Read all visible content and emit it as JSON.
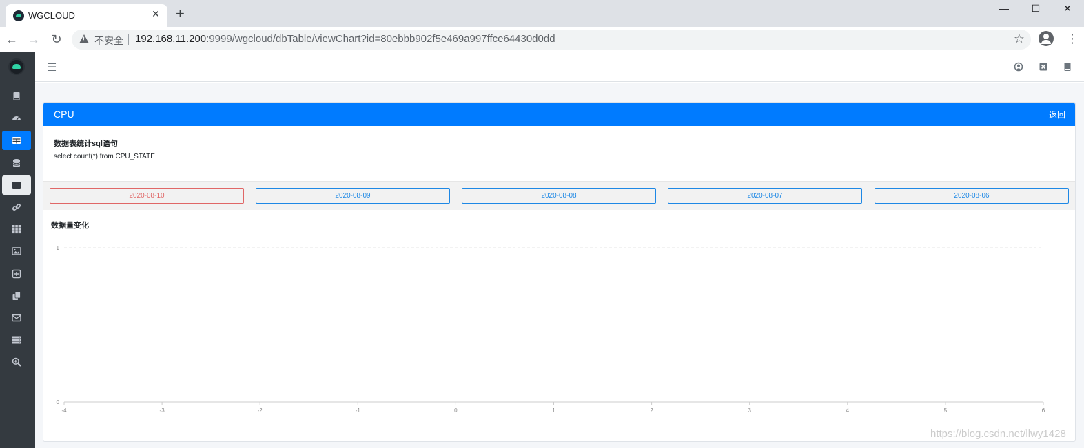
{
  "browser": {
    "tab_title": "WGCLOUD",
    "insecure_label": "不安全",
    "url_host": "192.168.11.200",
    "url_rest": ":9999/wgcloud/dbTable/viewChart?id=80ebbb902f5e469a997ffce64430d0dd"
  },
  "sidebar": {
    "items": [
      {
        "icon": "book-icon",
        "state": "normal"
      },
      {
        "icon": "dashboard-icon",
        "state": "normal"
      },
      {
        "icon": "table-icon",
        "state": "active"
      },
      {
        "icon": "database-icon",
        "state": "normal"
      },
      {
        "icon": "table-icon",
        "state": "hover"
      },
      {
        "icon": "link-icon",
        "state": "normal"
      },
      {
        "icon": "grid-icon",
        "state": "normal"
      },
      {
        "icon": "image-icon",
        "state": "normal"
      },
      {
        "icon": "plus-square-icon",
        "state": "normal"
      },
      {
        "icon": "copy-icon",
        "state": "normal"
      },
      {
        "icon": "envelope-icon",
        "state": "normal"
      },
      {
        "icon": "server-icon",
        "state": "normal"
      },
      {
        "icon": "search-plus-icon",
        "state": "normal"
      }
    ]
  },
  "card": {
    "title": "CPU",
    "back_label": "返回",
    "sql_title": "数据表统计sql语句",
    "sql_text": "select count(*) from CPU_STATE"
  },
  "dates": [
    "2020-08-10",
    "2020-08-09",
    "2020-08-08",
    "2020-08-07",
    "2020-08-06"
  ],
  "selected_date": "2020-08-10",
  "chart_title": "数据量变化",
  "chart_data": {
    "type": "line",
    "title": "数据量变化",
    "x_ticks": [
      "-4",
      "-3",
      "-2",
      "-1",
      "0",
      "1",
      "2",
      "3",
      "4",
      "5",
      "6"
    ],
    "y_ticks": [
      "0",
      "1"
    ],
    "xlim": [
      -4,
      6
    ],
    "ylim": [
      0,
      1
    ],
    "series": [],
    "grid": true
  },
  "watermark": "https://blog.csdn.net/llwy1428",
  "colors": {
    "primary": "#007bff",
    "sidebar": "#343a40",
    "selected": "#e06767",
    "date_border": "#1e88e5"
  }
}
